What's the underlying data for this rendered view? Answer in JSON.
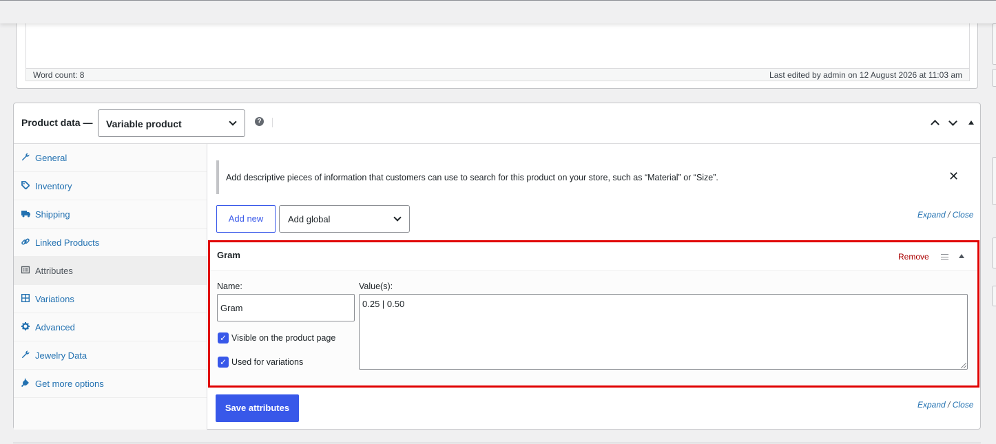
{
  "editor": {
    "word_count": "Word count: 8",
    "last_edited": "Last edited by admin on 12 August 2026 at 11:03 am"
  },
  "product_data": {
    "title": "Product data —",
    "type_selected": "Variable product",
    "help_icon": "?",
    "tabs": [
      {
        "label": "General",
        "icon": "wrench-icon",
        "active": false
      },
      {
        "label": "Inventory",
        "icon": "tag-icon",
        "active": false
      },
      {
        "label": "Shipping",
        "icon": "truck-icon",
        "active": false
      },
      {
        "label": "Linked Products",
        "icon": "link-icon",
        "active": false
      },
      {
        "label": "Attributes",
        "icon": "list-icon",
        "active": true
      },
      {
        "label": "Variations",
        "icon": "grid-icon",
        "active": false
      },
      {
        "label": "Advanced",
        "icon": "gear-icon",
        "active": false
      },
      {
        "label": "Jewelry Data",
        "icon": "wrench-icon",
        "active": false
      },
      {
        "label": "Get more options",
        "icon": "plug-icon",
        "active": false
      }
    ]
  },
  "attributes": {
    "notice": "Add descriptive pieces of information that customers can use to search for this product on your store, such as “Material” or “Size”.",
    "notice_close": "✕",
    "add_new_label": "Add new",
    "add_global_label": "Add global",
    "expand_label": "Expand",
    "slash": "/",
    "close_label": "Close",
    "attribute": {
      "title": "Gram",
      "remove_label": "Remove",
      "name_label": "Name:",
      "name_value": "Gram",
      "values_label": "Value(s):",
      "values_value": "0.25 | 0.50",
      "visible_label": "Visible on the product page",
      "visible_checked": true,
      "variations_label": "Used for variations",
      "variations_checked": true
    },
    "save_label": "Save attributes"
  },
  "colors": {
    "accent": "#3858e9",
    "link": "#2271b1",
    "remove": "#aa0000",
    "highlight_border": "#e00000"
  }
}
